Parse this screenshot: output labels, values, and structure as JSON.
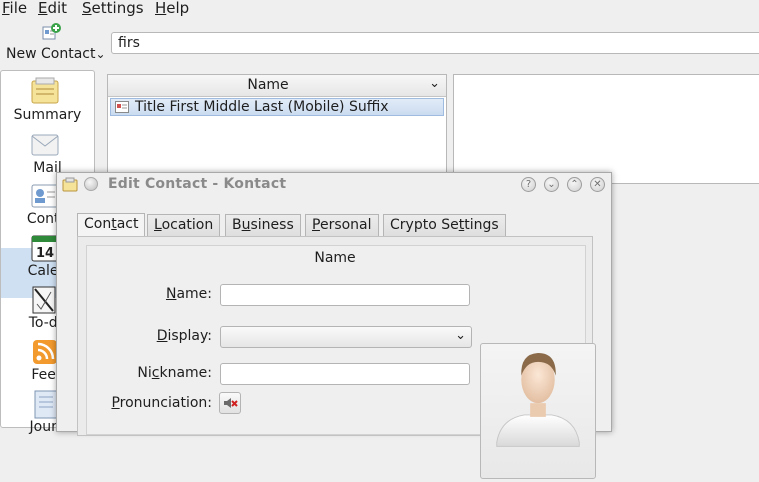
{
  "menubar": {
    "items": [
      {
        "label": "File",
        "mnemonic": "F",
        "rest": "ile"
      },
      {
        "label": "Edit",
        "mnemonic": "E",
        "rest": "dit"
      },
      {
        "label": "Settings",
        "mnemonic": "S",
        "rest": "ettings"
      },
      {
        "label": "Help",
        "mnemonic": "H",
        "rest": "elp"
      }
    ]
  },
  "toolbar": {
    "new_contact_label": "New Contact",
    "new_contact_icon": "contact-new-icon",
    "new_contact_arrow": "⌄",
    "search_value": "firs"
  },
  "sidebar": {
    "items": [
      {
        "label": "Summary",
        "icon": "summary-icon"
      },
      {
        "label": "Mail",
        "icon": "mail-icon"
      },
      {
        "label": "Conta",
        "icon": "contacts-icon",
        "selected": true
      },
      {
        "label": "Calen",
        "icon": "calendar-icon",
        "day": "14"
      },
      {
        "label": "To-do",
        "icon": "todo-icon"
      },
      {
        "label": "Feec",
        "icon": "feeds-icon"
      },
      {
        "label": "Journ",
        "icon": "journal-icon"
      }
    ]
  },
  "contact_list": {
    "header": "Name",
    "header_chevron": "⌄",
    "rows": [
      {
        "label": "Title First Middle Last (Mobile) Suffix",
        "icon": "vcard-icon"
      }
    ]
  },
  "dialog": {
    "title": "Edit Contact - Kontact",
    "window_buttons": [
      "?",
      "⌄",
      "⌃",
      "✕"
    ],
    "tabs": [
      {
        "label": "Contact",
        "pre": "Con",
        "mn": "t",
        "post": "act",
        "active": true
      },
      {
        "label": "Location",
        "pre": "",
        "mn": "L",
        "post": "ocation"
      },
      {
        "label": "Business",
        "pre": "B",
        "mn": "u",
        "post": "siness"
      },
      {
        "label": "Personal",
        "pre": "",
        "mn": "P",
        "post": "ersonal"
      },
      {
        "label": "Crypto Settings",
        "pre": "Crypto Se",
        "mn": "t",
        "post": "tings"
      }
    ],
    "name_section": "Name",
    "fields": {
      "name": {
        "pre": "",
        "mn": "N",
        "post": "ame:",
        "value": ""
      },
      "display": {
        "pre": "",
        "mn": "D",
        "post": "isplay:",
        "value": ""
      },
      "nickname": {
        "pre": "Ni",
        "mn": "c",
        "post": "kname:",
        "value": ""
      },
      "pronunciation": {
        "pre": "",
        "mn": "P",
        "post": "ronunciation:"
      }
    },
    "display_chevron": "⌄",
    "photo_icon": "person-placeholder-icon"
  },
  "colors": {
    "selection": "#cfe0f3",
    "window_bg": "#efefef",
    "title_text": "#8a8a8a"
  }
}
